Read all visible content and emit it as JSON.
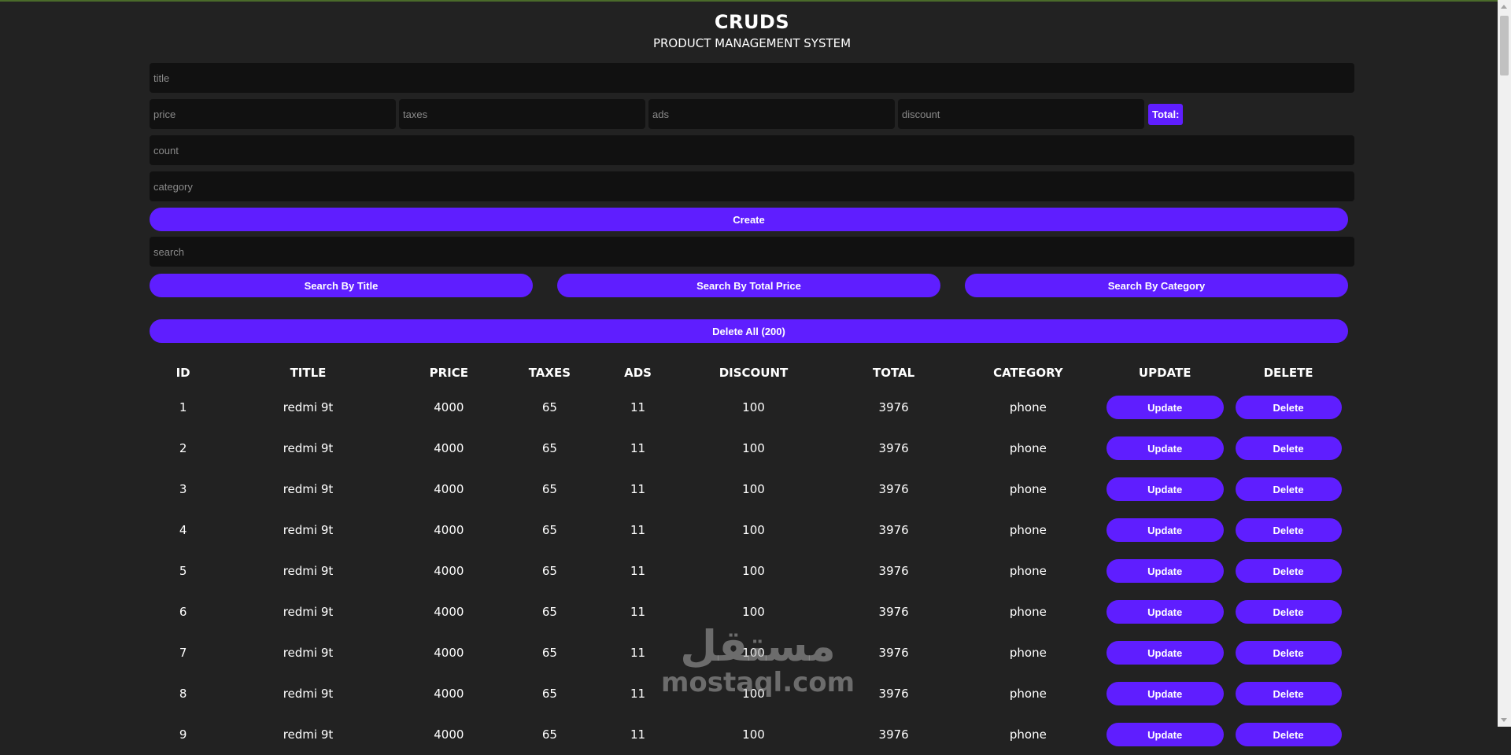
{
  "header": {
    "title": "CRUDS",
    "subtitle": "PRODUCT MANAGEMENT SYSTEM"
  },
  "form": {
    "title_placeholder": "title",
    "price_placeholder": "price",
    "taxes_placeholder": "taxes",
    "ads_placeholder": "ads",
    "discount_placeholder": "discount",
    "total_label": "Total:",
    "count_placeholder": "count",
    "category_placeholder": "category",
    "create_label": "Create"
  },
  "search": {
    "placeholder": "search",
    "by_title_label": "Search By Title",
    "by_total_price_label": "Search By Total Price",
    "by_category_label": "Search By Category"
  },
  "delete_all_label": "Delete All (200)",
  "table": {
    "headers": [
      "ID",
      "TITLE",
      "PRICE",
      "TAXES",
      "ADS",
      "DISCOUNT",
      "TOTAL",
      "CATEGORY",
      "UPDATE",
      "DELETE"
    ],
    "update_label": "Update",
    "delete_label": "Delete",
    "rows": [
      {
        "id": "1",
        "title": "redmi 9t",
        "price": "4000",
        "taxes": "65",
        "ads": "11",
        "discount": "100",
        "total": "3976",
        "category": "phone"
      },
      {
        "id": "2",
        "title": "redmi 9t",
        "price": "4000",
        "taxes": "65",
        "ads": "11",
        "discount": "100",
        "total": "3976",
        "category": "phone"
      },
      {
        "id": "3",
        "title": "redmi 9t",
        "price": "4000",
        "taxes": "65",
        "ads": "11",
        "discount": "100",
        "total": "3976",
        "category": "phone"
      },
      {
        "id": "4",
        "title": "redmi 9t",
        "price": "4000",
        "taxes": "65",
        "ads": "11",
        "discount": "100",
        "total": "3976",
        "category": "phone"
      },
      {
        "id": "5",
        "title": "redmi 9t",
        "price": "4000",
        "taxes": "65",
        "ads": "11",
        "discount": "100",
        "total": "3976",
        "category": "phone"
      },
      {
        "id": "6",
        "title": "redmi 9t",
        "price": "4000",
        "taxes": "65",
        "ads": "11",
        "discount": "100",
        "total": "3976",
        "category": "phone"
      },
      {
        "id": "7",
        "title": "redmi 9t",
        "price": "4000",
        "taxes": "65",
        "ads": "11",
        "discount": "100",
        "total": "3976",
        "category": "phone"
      },
      {
        "id": "8",
        "title": "redmi 9t",
        "price": "4000",
        "taxes": "65",
        "ads": "11",
        "discount": "100",
        "total": "3976",
        "category": "phone"
      },
      {
        "id": "9",
        "title": "redmi 9t",
        "price": "4000",
        "taxes": "65",
        "ads": "11",
        "discount": "100",
        "total": "3976",
        "category": "phone"
      }
    ]
  },
  "watermark": {
    "arabic": "مستقل",
    "latin": "mostaql.com"
  },
  "colors": {
    "accent": "#5f1eff",
    "background": "#222222",
    "input_background": "#111111"
  }
}
